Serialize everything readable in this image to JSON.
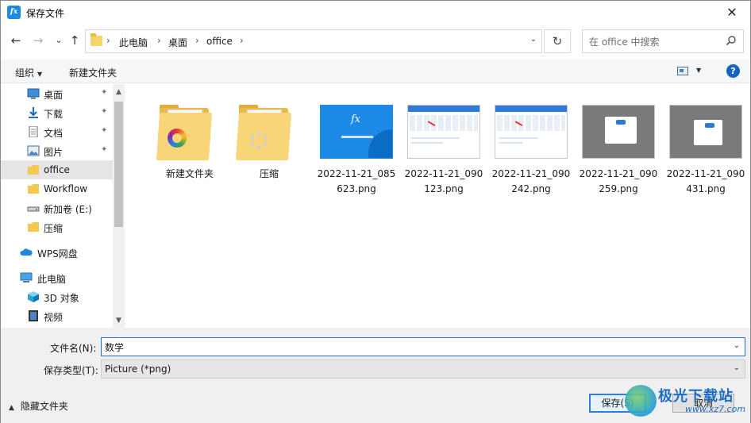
{
  "window": {
    "title": "保存文件",
    "app_icon_text": "fx",
    "close_glyph": "✕"
  },
  "navigation": {
    "back_glyph": "←",
    "forward_glyph": "→",
    "recent_glyph": "⌄",
    "up_glyph": "↑",
    "breadcrumb": [
      "此电脑",
      "桌面",
      "office"
    ],
    "crumb_sep": "›",
    "refresh_glyph": "↻",
    "dropdown_glyph": "⌄",
    "search_placeholder": "在 office 中搜索"
  },
  "toolbar": {
    "organize_label": "组织",
    "organize_caret": "▼",
    "new_folder_label": "新建文件夹",
    "view_caret": "▼",
    "help_glyph": "?"
  },
  "sidebar": {
    "items": [
      {
        "label": "桌面",
        "icon": "desktop-icon",
        "pinned": true
      },
      {
        "label": "下载",
        "icon": "download-icon",
        "pinned": true
      },
      {
        "label": "文档",
        "icon": "document-icon",
        "pinned": true
      },
      {
        "label": "图片",
        "icon": "picture-icon",
        "pinned": true
      },
      {
        "label": "office",
        "icon": "folder-icon",
        "pinned": false,
        "selected": true
      },
      {
        "label": "Workflow",
        "icon": "folder-icon",
        "pinned": false
      },
      {
        "label": "新加卷 (E:)",
        "icon": "drive-icon",
        "pinned": false
      },
      {
        "label": "压缩",
        "icon": "folder-icon",
        "pinned": false
      },
      {
        "label": "WPS网盘",
        "icon": "cloud-icon",
        "pinned": false
      },
      {
        "label": "此电脑",
        "icon": "computer-icon",
        "pinned": false
      },
      {
        "label": "3D 对象",
        "icon": "cube-icon",
        "pinned": false
      },
      {
        "label": "视频",
        "icon": "video-icon",
        "pinned": false
      }
    ],
    "pin_glyph": "📌",
    "scroll_up_glyph": "▲",
    "scroll_down_glyph": "▼"
  },
  "files": [
    {
      "name": "新建文件夹",
      "kind": "folder"
    },
    {
      "name": "压缩",
      "kind": "folder"
    },
    {
      "name": "2022-11-21_085623.png",
      "kind": "image"
    },
    {
      "name": "2022-11-21_090123.png",
      "kind": "image"
    },
    {
      "name": "2022-11-21_090242.png",
      "kind": "image"
    },
    {
      "name": "2022-11-21_090259.png",
      "kind": "image"
    },
    {
      "name": "2022-11-21_090431.png",
      "kind": "image"
    }
  ],
  "form": {
    "filename_label": "文件名(N):",
    "filename_value": "数学",
    "filetype_label": "保存类型(T):",
    "filetype_value": "Picture (*png)",
    "caret_glyph": "⌄",
    "hide_folders_label": "隐藏文件夹",
    "hide_folders_glyph": "▲",
    "save_label": "保存(S)",
    "cancel_label": "取消"
  },
  "watermark": {
    "text": "极光下载站",
    "url": "www.xz7.com"
  }
}
